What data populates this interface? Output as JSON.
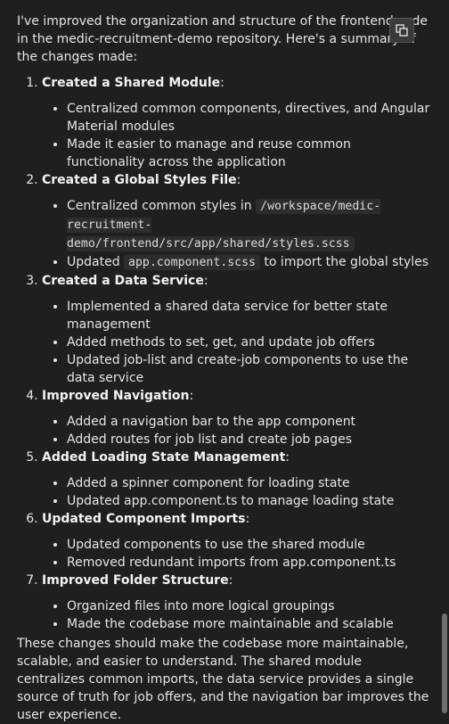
{
  "intro": "I've improved the organization and structure of the frontend code in the medic-recruitment-demo repository. Here's a summary of the changes made:",
  "sections": [
    {
      "title": "Created a Shared Module",
      "items": [
        {
          "text": "Centralized common components, directives, and Angular Material modules"
        },
        {
          "text": "Made it easier to manage and reuse common functionality across the application"
        }
      ]
    },
    {
      "title": "Created a Global Styles File",
      "items": [
        {
          "pre": "Centralized common styles in ",
          "code": "/workspace/medic-recruitment-demo/frontend/src/app/shared/styles.scss",
          "post": ""
        },
        {
          "pre": "Updated ",
          "code": "app.component.scss",
          "post": " to import the global styles"
        }
      ]
    },
    {
      "title": "Created a Data Service",
      "items": [
        {
          "text": "Implemented a shared data service for better state management"
        },
        {
          "text": "Added methods to set, get, and update job offers"
        },
        {
          "text": "Updated job-list and create-job components to use the data service"
        }
      ]
    },
    {
      "title": "Improved Navigation",
      "items": [
        {
          "text": "Added a navigation bar to the app component"
        },
        {
          "text": "Added routes for job list and create job pages"
        }
      ]
    },
    {
      "title": "Added Loading State Management",
      "items": [
        {
          "text": "Added a spinner component for loading state"
        },
        {
          "text": "Updated app.component.ts to manage loading state"
        }
      ]
    },
    {
      "title": "Updated Component Imports",
      "items": [
        {
          "text": "Updated components to use the shared module"
        },
        {
          "text": "Removed redundant imports from app.component.ts"
        }
      ]
    },
    {
      "title": "Improved Folder Structure",
      "items": [
        {
          "text": "Organized files into more logical groupings"
        },
        {
          "text": "Made the codebase more maintainable and scalable"
        }
      ]
    }
  ],
  "outro": "These changes should make the codebase more maintainable, scalable, and easier to understand. The shared module centralizes common imports, the data service provides a single source of truth for job offers, and the navigation bar improves the user experience.",
  "copy_icon": "copy-icon"
}
